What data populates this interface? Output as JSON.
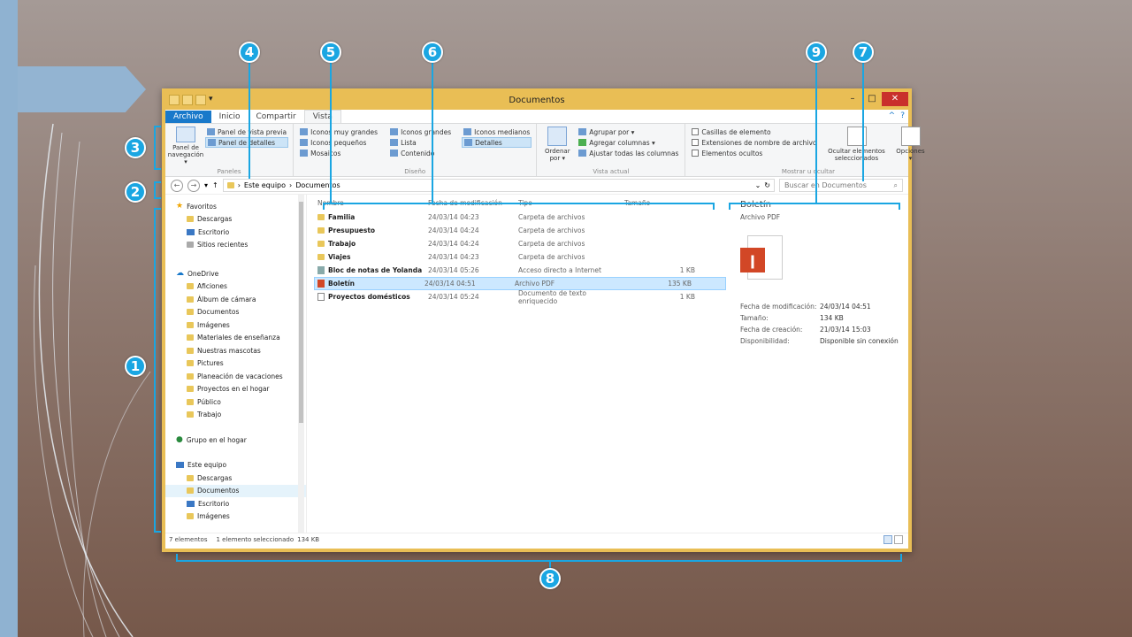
{
  "window": {
    "title": "Documentos",
    "qat_icons": [
      "properties-icon",
      "new-folder-icon",
      "folder-icon",
      "dropdown-icon"
    ],
    "controls": {
      "minimize": "–",
      "maximize": "□",
      "close": "✕"
    }
  },
  "ribbon": {
    "tabs": [
      "Archivo",
      "Inicio",
      "Compartir",
      "Vista"
    ],
    "active_tab": "Vista",
    "help_icons": {
      "collapse": "^",
      "help": "?"
    },
    "groups": {
      "panels": {
        "name": "Paneles",
        "nav_pane": "Panel de navegación ▾",
        "preview_pane": "Panel de vista previa",
        "details_pane": "Panel de detalles"
      },
      "layout": {
        "name": "Diseño",
        "items": [
          "Iconos muy grandes",
          "Iconos grandes",
          "Iconos medianos",
          "Iconos pequeños",
          "Lista",
          "Detalles",
          "Mosaicos",
          "Contenido"
        ],
        "selected": "Detalles"
      },
      "current_view": {
        "name": "Vista actual",
        "sort_by": "Ordenar por ▾",
        "items": [
          "Agrupar por ▾",
          "Agregar columnas ▾",
          "Ajustar todas las columnas"
        ]
      },
      "show_hide": {
        "name": "Mostrar u ocultar",
        "items": [
          "Casillas de elemento",
          "Extensiones de nombre de archivo",
          "Elementos ocultos"
        ],
        "hide_selected": "Ocultar elementos seleccionados",
        "options": "Opciones ▾"
      }
    }
  },
  "address": {
    "back": "←",
    "forward": "→",
    "recent": "▾",
    "up": "↑",
    "segments": [
      "Este equipo",
      "Documentos"
    ],
    "refresh_icons": {
      "dropdown": "⌄",
      "refresh": "↻"
    },
    "search_placeholder": "Buscar en Documentos",
    "search_icon": "⌕"
  },
  "nav_pane": {
    "favorites": {
      "label": "Favoritos",
      "items": [
        "Descargas",
        "Escritorio",
        "Sitios recientes"
      ]
    },
    "onedrive": {
      "label": "OneDrive",
      "items": [
        "Aficiones",
        "Álbum de cámara",
        "Documentos",
        "Imágenes",
        "Materiales de enseñanza",
        "Nuestras mascotas",
        "Pictures",
        "Planeación de vacaciones",
        "Proyectos en el hogar",
        "Público",
        "Trabajo"
      ]
    },
    "homegroup": {
      "label": "Grupo en el hogar"
    },
    "this_pc": {
      "label": "Este equipo",
      "items": [
        "Descargas",
        "Documentos",
        "Escritorio",
        "Imágenes"
      ],
      "selected": "Documentos"
    }
  },
  "file_list": {
    "columns": [
      "Nombre",
      "Fecha de modificación",
      "Tipo",
      "Tamaño"
    ],
    "rows": [
      {
        "name": "Familia",
        "date": "24/03/14 04:23",
        "type": "Carpeta de archivos",
        "size": "",
        "icon": "folder-icon"
      },
      {
        "name": "Presupuesto",
        "date": "24/03/14 04:24",
        "type": "Carpeta de archivos",
        "size": "",
        "icon": "folder-icon"
      },
      {
        "name": "Trabajo",
        "date": "24/03/14 04:24",
        "type": "Carpeta de archivos",
        "size": "",
        "icon": "folder-icon"
      },
      {
        "name": "Viajes",
        "date": "24/03/14 04:23",
        "type": "Carpeta de archivos",
        "size": "",
        "icon": "folder-icon"
      },
      {
        "name": "Bloc de notas de Yolanda",
        "date": "24/03/14 05:26",
        "type": "Acceso directo a Internet",
        "size": "1 KB",
        "icon": "shortcut-icon"
      },
      {
        "name": "Boletín",
        "date": "24/03/14 04:51",
        "type": "Archivo PDF",
        "size": "135 KB",
        "icon": "pdf-icon"
      },
      {
        "name": "Proyectos domésticos",
        "date": "24/03/14 05:24",
        "type": "Documento de texto enriquecido",
        "size": "1 KB",
        "icon": "document-icon"
      }
    ],
    "selected_index": 5
  },
  "preview": {
    "title": "Boletín",
    "type": "Archivo PDF",
    "fields": [
      {
        "k": "Fecha de modificación:",
        "v": "24/03/14 04:51"
      },
      {
        "k": "Tamaño:",
        "v": "134 KB"
      },
      {
        "k": "Fecha de creación:",
        "v": "21/03/14 15:03"
      },
      {
        "k": "Disponibilidad:",
        "v": "Disponible sin conexión"
      }
    ]
  },
  "status": {
    "count": "7 elementos",
    "selection": "1 elemento seleccionado",
    "size": "134 KB"
  },
  "callouts": [
    "1",
    "2",
    "3",
    "4",
    "5",
    "6",
    "7",
    "8",
    "9"
  ],
  "colors": {
    "accent": "#1aa6e2",
    "window_frame": "#e9be55",
    "file_tab": "#1979ca"
  }
}
